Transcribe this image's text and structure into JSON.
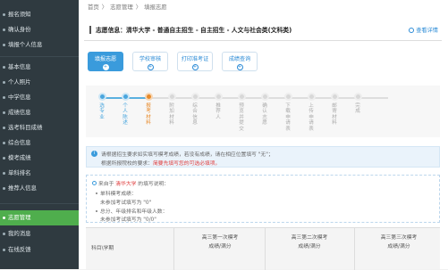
{
  "sidebar": {
    "top_items": [
      {
        "label": "报名须知"
      },
      {
        "label": "确认身份"
      },
      {
        "label": "填报个人信息"
      }
    ],
    "info_items": [
      {
        "label": "基本信息"
      },
      {
        "label": "个人照片"
      },
      {
        "label": "中学信息"
      },
      {
        "label": "成绩信息"
      },
      {
        "label": "选考科目成绩"
      },
      {
        "label": "综合信息"
      },
      {
        "label": "模考成绩"
      },
      {
        "label": "单科排名"
      },
      {
        "label": "推荐人信息"
      }
    ],
    "bottom_items": [
      {
        "label": "志愿管理",
        "active": true
      },
      {
        "label": "我的消息"
      },
      {
        "label": "在线反馈"
      }
    ]
  },
  "breadcrumb": {
    "home": "首页",
    "sep1": "〉",
    "section": "志愿管理",
    "sep2": "〉",
    "current": "填报志愿"
  },
  "headline": {
    "text": "志愿信息：清华大学 - 普通自主招生 - 自主招生 - 人文与社会类(文科类)",
    "detail": "查看详情"
  },
  "tabs": [
    {
      "label": "填报志愿",
      "active": true
    },
    {
      "label": "学校审核"
    },
    {
      "label": "打印准考证"
    },
    {
      "label": "成绩查询"
    }
  ],
  "steps": [
    {
      "label": "选专业",
      "state": "done"
    },
    {
      "label": "个人陈述",
      "state": "done"
    },
    {
      "label": "报考材料",
      "state": "cur"
    },
    {
      "label": "附加材料",
      "state": "todo"
    },
    {
      "label": "综合信息",
      "state": "todo"
    },
    {
      "label": "推荐人",
      "state": "todo"
    },
    {
      "label": "预览并提交",
      "state": "todo"
    },
    {
      "label": "确认志愿",
      "state": "todo"
    },
    {
      "label": "下载申请表",
      "state": "todo"
    },
    {
      "label": "上传申请表",
      "state": "todo"
    },
    {
      "label": "邮寄材料",
      "state": "todo"
    },
    {
      "label": "完成",
      "state": "todo"
    }
  ],
  "notice": {
    "line1": "请根据招生要求如实填写模考成绩，若没有成绩，请在相应位置填写 \"无\"；",
    "line2_prefix": "根据所报院校的要求：",
    "line2_red": "简要先填写您的可选必填项。"
  },
  "requirements": {
    "prefix": "来自于",
    "school": "清华大学",
    "suffix": "的填写说明：",
    "item1_title": "单科模考成绩：",
    "item1_value": "未参加考试填写为 \"0\"",
    "item2_title": "总分、年级排名和年级人数：",
    "item2_value": "未参加考试填写为 \"0/0\""
  },
  "table": {
    "col0": "科目\\学期",
    "cols": [
      {
        "l1": "高三第一次模考",
        "l2": "成绩/满分"
      },
      {
        "l1": "高三第二次模考",
        "l2": "成绩/满分"
      },
      {
        "l1": "高三第三次模考",
        "l2": "成绩/满分"
      }
    ]
  }
}
